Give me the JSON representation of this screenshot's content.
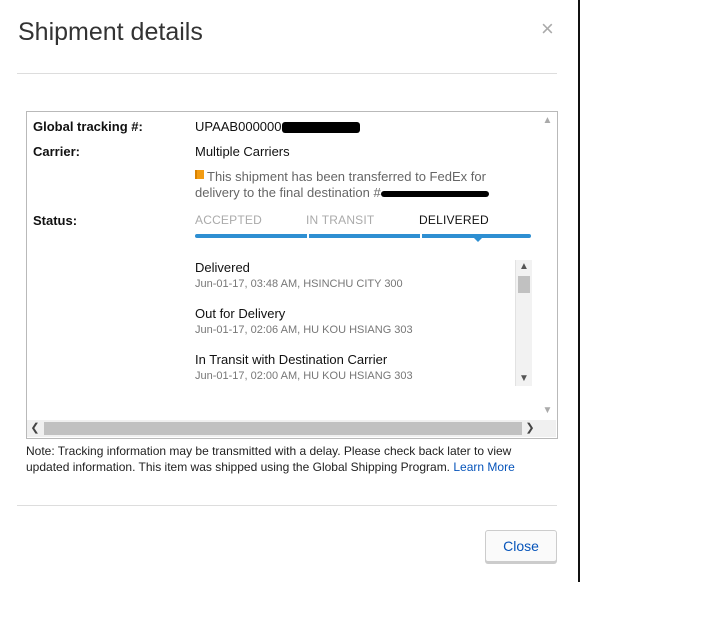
{
  "dialog": {
    "title": "Shipment details",
    "close_icon": "×",
    "close_button": "Close"
  },
  "details": {
    "tracking_label": "Global tracking #:",
    "tracking_value": "UPAAB000000",
    "carrier_label": "Carrier:",
    "carrier_value": "Multiple Carriers",
    "transfer_line1": "This shipment has been transferred to FedEx for",
    "transfer_line2": "delivery to the final destination #",
    "status_label": "Status:"
  },
  "status_steps": [
    "ACCEPTED",
    "IN TRANSIT",
    "DELIVERED"
  ],
  "status_progress": 0.85,
  "events": [
    {
      "title": "Delivered",
      "detail": "Jun-01-17, 03:48 AM, HSINCHU CITY 300"
    },
    {
      "title": "Out for Delivery",
      "detail": "Jun-01-17, 02:06 AM, HU KOU HSIANG 303"
    },
    {
      "title": "In Transit with Destination Carrier",
      "detail": "Jun-01-17, 02:00 AM, HU KOU HSIANG 303"
    }
  ],
  "note": {
    "text": "Note: Tracking information may be transmitted with a delay. Please check back later to view updated information. This item was shipped using the Global Shipping Program.",
    "link": "Learn More"
  },
  "icons": {
    "flag": "flag-icon",
    "link_color": "#0654ba",
    "flag_color": "#f39c12",
    "progress_color": "#2e8fd2"
  }
}
